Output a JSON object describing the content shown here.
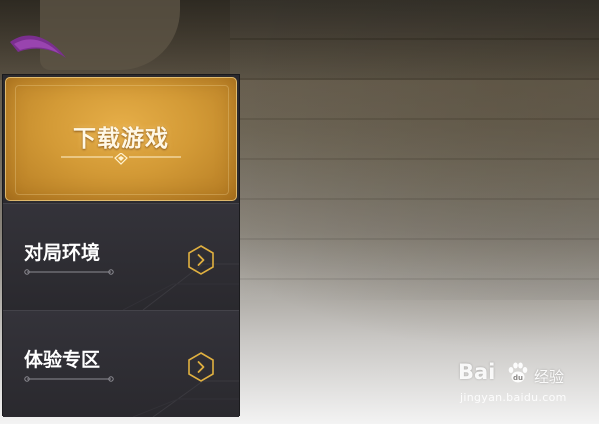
{
  "panel": {
    "download_label": "下载游戏",
    "items": [
      {
        "label": "对局环境",
        "icon": "chevron-right-icon"
      },
      {
        "label": "体验专区",
        "icon": "chevron-right-icon"
      }
    ]
  },
  "watermark": {
    "logo_text": "Bai",
    "paw_icon": "baidu-paw-icon",
    "cn_text": "经验",
    "url": "jingyan.baidu.com"
  },
  "colors": {
    "gold": "#d39a36",
    "panel_bg": "#2b2a2f",
    "accent": "#e0b040"
  }
}
